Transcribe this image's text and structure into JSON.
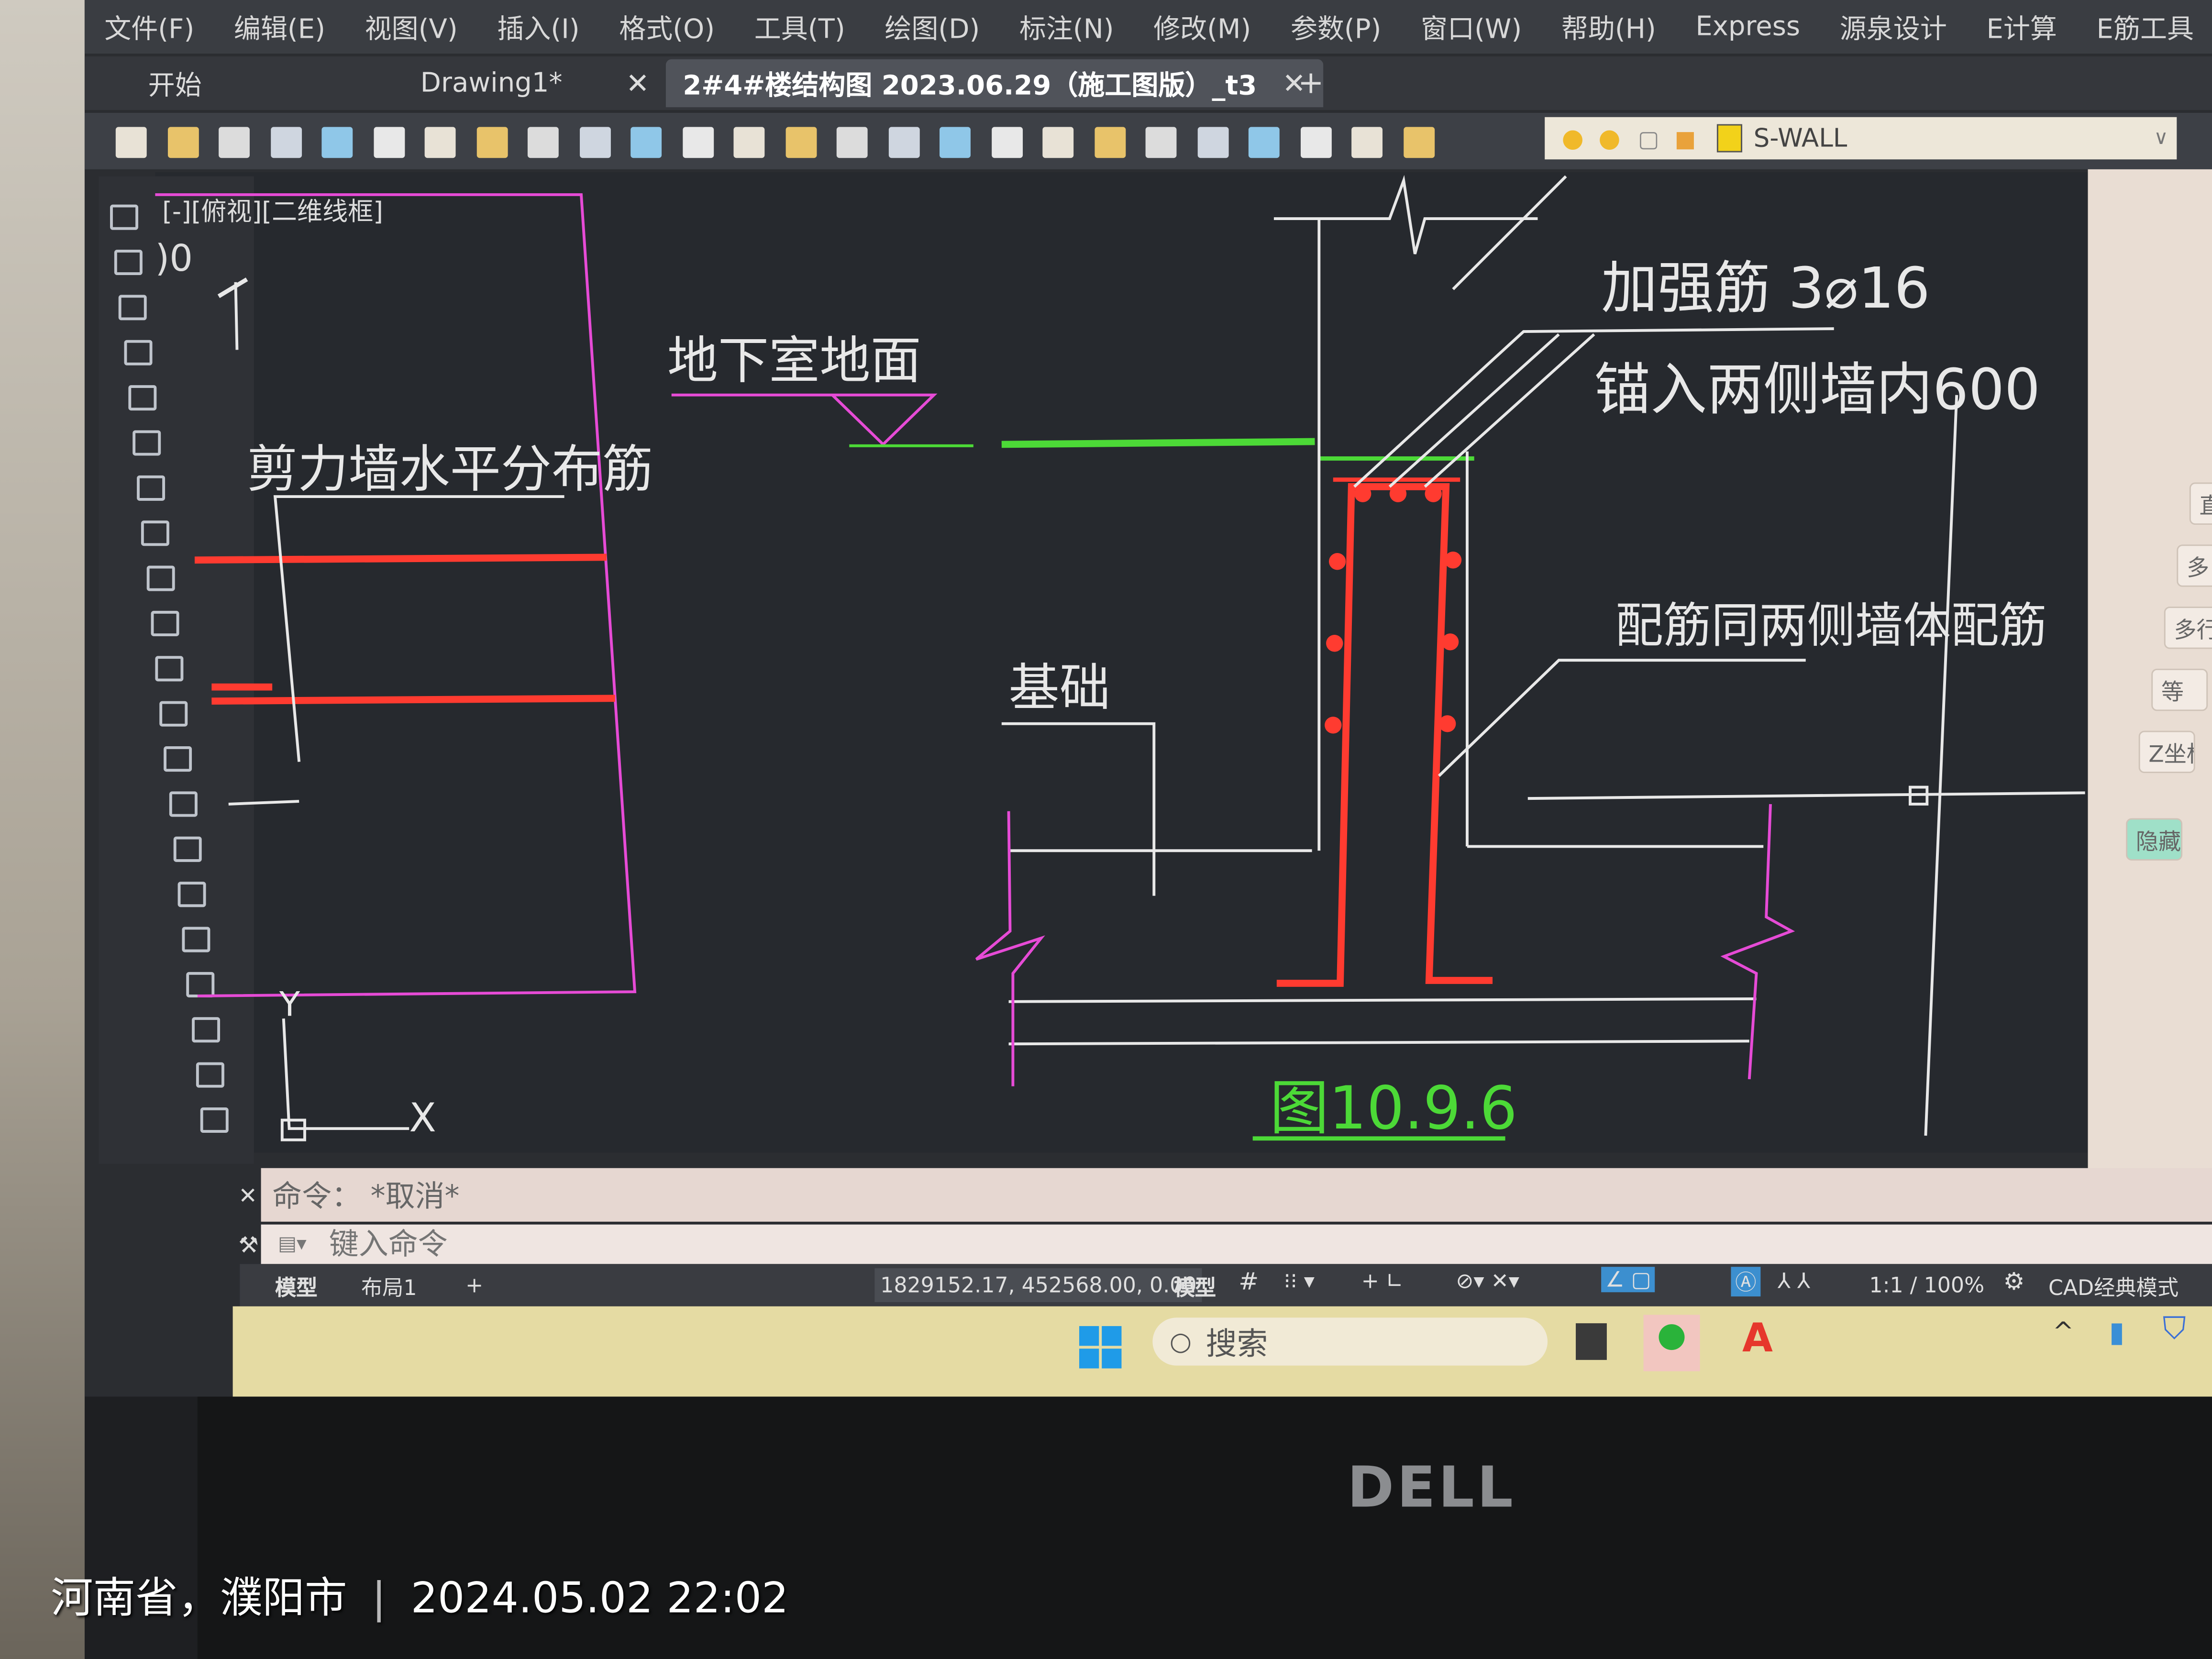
{
  "menu": [
    "文件(F)",
    "编辑(E)",
    "视图(V)",
    "插入(I)",
    "格式(O)",
    "工具(T)",
    "绘图(D)",
    "标注(N)",
    "修改(M)",
    "参数(P)",
    "窗口(W)",
    "帮助(H)",
    "Express",
    "源泉设计",
    "E计算",
    "E筋工具"
  ],
  "tabs": [
    {
      "label": "开始",
      "active": false
    },
    {
      "label": "Drawing1*",
      "active": false
    },
    {
      "label": "2#4#楼结构图 2023.06.29（施工图版）_t3",
      "active": true
    }
  ],
  "toolbar_icons": [
    "new-icon",
    "open-icon",
    "save-icon",
    "print-icon",
    "preview-icon",
    "plot-icon",
    "publish-icon",
    "cut-icon",
    "copy-icon",
    "paste-icon",
    "match-icon",
    "block-icon",
    "undo-icon",
    "redo-icon",
    "pan-icon",
    "zoom-realtime-icon",
    "zoom-window-icon",
    "zoom-previous-icon",
    "properties-icon",
    "design-center-icon",
    "tool-palette-icon",
    "sheet-set-icon",
    "markup-icon",
    "calculator-icon",
    "help-icon",
    "layer-manager-icon"
  ],
  "layer": {
    "name": "S-WALL",
    "color": "#f2d21a"
  },
  "left_tools": [
    "line-icon",
    "construction-line-icon",
    "polyline-icon",
    "polygon-icon",
    "rectangle-icon",
    "arc-icon",
    "circle-icon",
    "revcloud-icon",
    "spline-icon",
    "ellipse-icon",
    "insert-block-icon",
    "make-block-icon",
    "point-icon",
    "hatch-icon",
    "gradient-icon",
    "region-icon",
    "table-icon",
    "mtext-icon",
    "text-icon",
    "dimension-icon",
    "leader-icon"
  ],
  "viewport": {
    "label": "[-][俯视][二维线框]",
    "scale_fragment": ")0"
  },
  "drawing": {
    "labels": {
      "shear_wall": "剪力墙水平分布筋",
      "basement_floor": "地下室地面",
      "reinforcement": "加强筋  3⌀16",
      "anchor": "锚入两侧墙内600",
      "same_rebar": "配筋同两侧墙体配筋",
      "foundation": "基础",
      "figure": "图10.9.6"
    },
    "ucs": {
      "x": "X",
      "y": "Y"
    },
    "colors": {
      "magenta": "#e64bd6",
      "red": "#ff3b30",
      "green": "#4cd937",
      "white": "#e8e8e8"
    }
  },
  "right_panel": {
    "buttons": [
      "直",
      "多",
      "多行",
      "等",
      "Z坐标",
      "隐藏"
    ]
  },
  "command": {
    "history": "命令：  *取消*",
    "placeholder": "键入命令"
  },
  "status": {
    "tabs": [
      "模型",
      "布局1",
      "+"
    ],
    "coords": "1829152.17, 452568.00, 0.00",
    "space": "模型",
    "scale": "1:1 / 100%",
    "workspace": "CAD经典模式"
  },
  "taskbar": {
    "search_placeholder": "搜索"
  },
  "monitor": {
    "brand": "DELL"
  },
  "watermark": {
    "location": "河南省，濮阳市",
    "datetime": "2024.05.02 22:02"
  }
}
